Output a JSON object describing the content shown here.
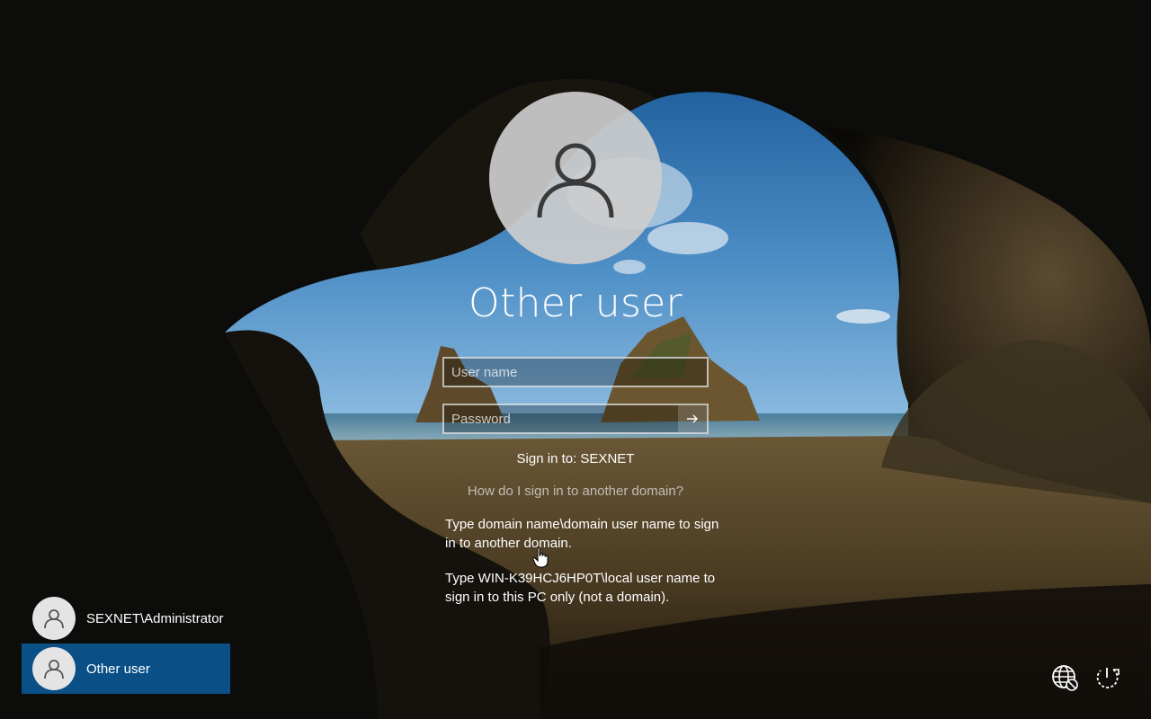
{
  "signin": {
    "title": "Other user",
    "username_placeholder": "User name",
    "password_placeholder": "Password",
    "sign_in_to": "Sign in to: SEXNET",
    "help_link": "How do I sign in to another domain?",
    "help_text_1": "Type domain name\\domain user name to sign in to another domain.",
    "help_text_2": "Type WIN-K39HCJ6HP0T\\local user name to sign in to this PC only (not a domain).",
    "submit_icon": "arrow-right-icon"
  },
  "users": [
    {
      "name": "SEXNET\\Administrator",
      "selected": false,
      "icon": "user-icon"
    },
    {
      "name": "Other user",
      "selected": true,
      "icon": "user-icon"
    }
  ],
  "corner": {
    "network_icon": "network-globe-icon",
    "power_icon": "power-icon"
  },
  "colors": {
    "selected_user_bg": "#0a4f86",
    "avatar_bg": "#cdcdcd"
  }
}
